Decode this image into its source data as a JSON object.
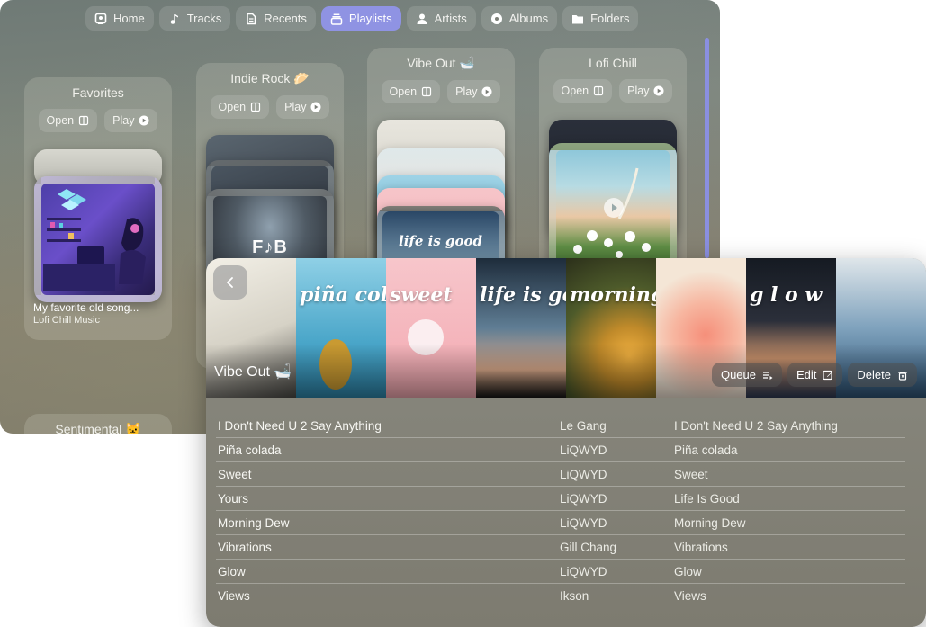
{
  "nav": {
    "tabs": [
      {
        "label": "Home",
        "icon": "home-icon"
      },
      {
        "label": "Tracks",
        "icon": "music-note-icon"
      },
      {
        "label": "Recents",
        "icon": "document-icon"
      },
      {
        "label": "Playlists",
        "icon": "playlist-icon",
        "active": true
      },
      {
        "label": "Artists",
        "icon": "person-icon"
      },
      {
        "label": "Albums",
        "icon": "disc-icon"
      },
      {
        "label": "Folders",
        "icon": "folder-icon"
      }
    ]
  },
  "playlists": [
    {
      "title": "Favorites",
      "open_label": "Open",
      "play_label": "Play",
      "featured_caption": "My favorite old song...",
      "featured_sub": "Lofi Chill Music"
    },
    {
      "title": "Indie Rock 🥟",
      "open_label": "Open",
      "play_label": "Play",
      "cover_text": "F♪B"
    },
    {
      "title": "Vibe Out 🛁",
      "open_label": "Open",
      "play_label": "Play",
      "cover_text": "life is good"
    },
    {
      "title": "Lofi Chill",
      "open_label": "Open",
      "play_label": "Play"
    },
    {
      "title": "Sentimental 🐱"
    }
  ],
  "detail": {
    "title": "Vibe Out 🛁",
    "back_icon": "chevron-left-icon",
    "actions": [
      {
        "label": "Queue",
        "icon": "queue-icon"
      },
      {
        "label": "Edit",
        "icon": "edit-icon"
      },
      {
        "label": "Delete",
        "icon": "trash-icon"
      }
    ],
    "hero_words": [
      "",
      "piña colada",
      "sweet",
      "life is good",
      "morning",
      "",
      "g l o w",
      ""
    ],
    "tracks": [
      {
        "title": "I Don't Need U 2 Say Anything",
        "artist": "Le Gang",
        "album": "I Don't Need U 2 Say Anything"
      },
      {
        "title": "Piña colada",
        "artist": "LiQWYD",
        "album": "Piña colada"
      },
      {
        "title": "Sweet",
        "artist": "LiQWYD",
        "album": "Sweet"
      },
      {
        "title": "Yours",
        "artist": "LiQWYD",
        "album": "Life Is Good"
      },
      {
        "title": "Morning Dew",
        "artist": "LiQWYD",
        "album": "Morning Dew"
      },
      {
        "title": "Vibrations",
        "artist": "Gill Chang",
        "album": "Vibrations"
      },
      {
        "title": "Glow",
        "artist": "LiQWYD",
        "album": "Glow"
      },
      {
        "title": "Views",
        "artist": "Ikson",
        "album": "Views"
      }
    ]
  },
  "colors": {
    "accent": "#8f93e3"
  }
}
